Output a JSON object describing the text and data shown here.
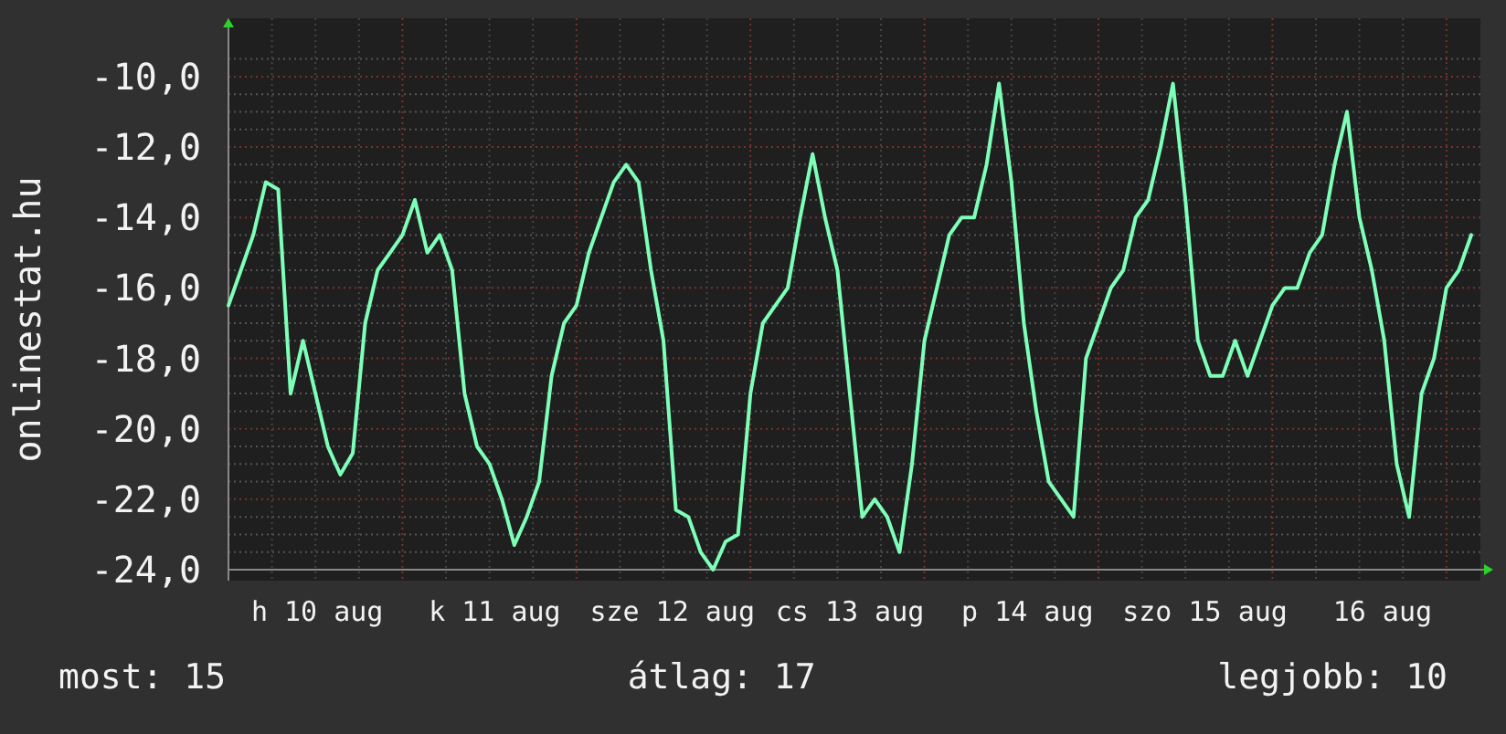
{
  "chart": {
    "x_labels": [
      "h 10 aug",
      "k 11 aug",
      "sze 12 aug",
      "cs 13 aug",
      "p 14 aug",
      "szo 15 aug",
      "16 aug"
    ],
    "chart_data": {
      "type": "line",
      "ylabel": "onlinestat.hu",
      "ylim": [
        -24,
        -9.5
      ],
      "grid": true,
      "yticks": [
        {
          "value": -10,
          "label": "-10,0"
        },
        {
          "value": -12,
          "label": "-12,0"
        },
        {
          "value": -14,
          "label": "-14,0"
        },
        {
          "value": -16,
          "label": "-16,0"
        },
        {
          "value": -18,
          "label": "-18,0"
        },
        {
          "value": -20,
          "label": "-20,0"
        },
        {
          "value": -22,
          "label": "-22,0"
        },
        {
          "value": -24,
          "label": "-24,0"
        }
      ],
      "series": [
        {
          "color": "#7dffb8",
          "values": [
            -16.5,
            -15.5,
            -14.5,
            -13,
            -13.2,
            -19,
            -17.5,
            -19,
            -20.5,
            -21.3,
            -20.7,
            -17,
            -15.5,
            -15,
            -14.5,
            -13.5,
            -15,
            -14.5,
            -15.5,
            -19,
            -20.5,
            -21,
            -22,
            -23.3,
            -22.5,
            -21.5,
            -18.5,
            -17,
            -16.5,
            -15,
            -14,
            -13,
            -12.5,
            -13,
            -15.5,
            -17.5,
            -22.3,
            -22.5,
            -23.5,
            -24,
            -23.2,
            -23,
            -19,
            -17,
            -16.5,
            -16,
            -14,
            -12.2,
            -14,
            -15.5,
            -19,
            -22.5,
            -22,
            -22.5,
            -23.5,
            -21,
            -17.5,
            -16,
            -14.5,
            -14,
            -14,
            -12.5,
            -10.2,
            -13,
            -17,
            -19.5,
            -21.5,
            -22,
            -22.5,
            -18,
            -17,
            -16,
            -15.5,
            -14,
            -13.5,
            -12,
            -10.2,
            -13.5,
            -17.5,
            -18.5,
            -18.5,
            -17.5,
            -18.5,
            -17.5,
            -16.5,
            -16,
            -16,
            -15,
            -14.5,
            -12.5,
            -11,
            -14,
            -15.5,
            -17.5,
            -21,
            -22.5,
            -19,
            -18,
            -16,
            -15.5,
            -14.5
          ]
        }
      ]
    }
  },
  "legend": [
    {
      "text": "most: 15"
    },
    {
      "text": "átlag: 17"
    },
    {
      "text": "legjobb: 10"
    }
  ]
}
